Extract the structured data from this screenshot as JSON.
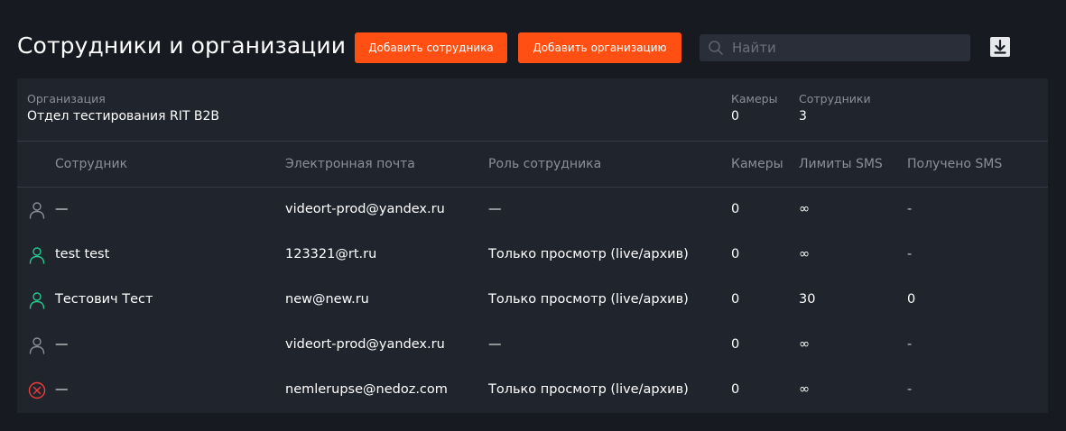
{
  "header": {
    "title": "Сотрудники и организации",
    "add_employee_label": "Добавить сотрудника",
    "add_organization_label": "Добавить организацию",
    "search_placeholder": "Найти",
    "search_value": ""
  },
  "organization": {
    "name_label": "Организация",
    "name": "Отдел тестирования RIT B2B",
    "cameras_label": "Камеры",
    "cameras": "0",
    "employees_label": "Сотрудники",
    "employees": "3"
  },
  "table": {
    "columns": {
      "employee": "Сотрудник",
      "email": "Электронная почта",
      "role": "Роль сотрудника",
      "cameras": "Камеры",
      "sms_limit": "Лимиты SMS",
      "sms_received": "Получено SMS"
    },
    "rows": [
      {
        "status_icon": "user-inactive-icon",
        "name": "—",
        "email": "videort-prod@yandex.ru",
        "role": "—",
        "cameras": "0",
        "sms_limit": "∞",
        "sms_received": "-"
      },
      {
        "status_icon": "user-active-icon",
        "name": "test test",
        "email": "123321@rt.ru",
        "role": "Только просмотр (live/архив)",
        "cameras": "0",
        "sms_limit": "∞",
        "sms_received": "-"
      },
      {
        "status_icon": "user-active-icon",
        "name": "Тестович Тест",
        "email": "new@new.ru",
        "role": "Только просмотр (live/архив)",
        "cameras": "0",
        "sms_limit": "30",
        "sms_received": "0"
      },
      {
        "status_icon": "user-inactive-icon",
        "name": "—",
        "email": "videort-prod@yandex.ru",
        "role": "—",
        "cameras": "0",
        "sms_limit": "∞",
        "sms_received": "-"
      },
      {
        "status_icon": "blocked-icon",
        "name": "—",
        "email": "nemlerupse@nedoz.com",
        "role": "Только просмотр (live/архив)",
        "cameras": "0",
        "sms_limit": "∞",
        "sms_received": "-"
      }
    ]
  },
  "colors": {
    "background": "#171a21",
    "panel": "#20242d",
    "accent": "#ff4f12",
    "active_user": "#23c98f",
    "inactive_user": "#8a8f9a",
    "blocked": "#f03c3c"
  }
}
